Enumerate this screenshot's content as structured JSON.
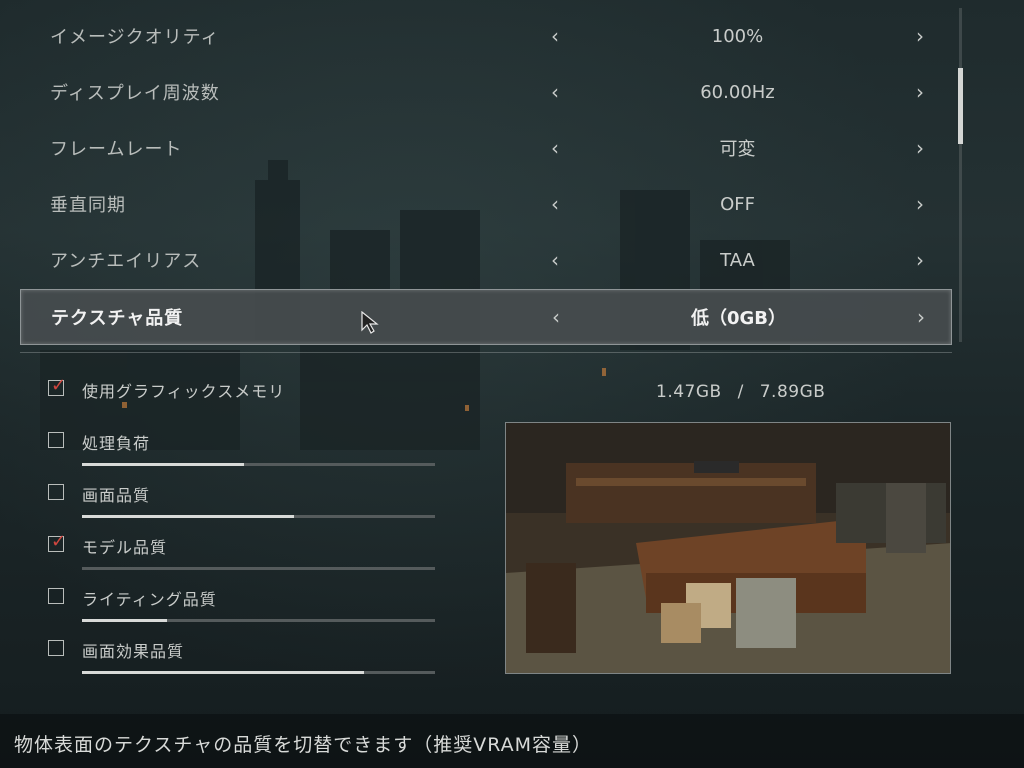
{
  "settings": {
    "rows": [
      {
        "label": "イメージクオリティ",
        "value": "100%"
      },
      {
        "label": "ディスプレイ周波数",
        "value": "60.00Hz"
      },
      {
        "label": "フレームレート",
        "value": "可変"
      },
      {
        "label": "垂直同期",
        "value": "OFF"
      },
      {
        "label": "アンチエイリアス",
        "value": "TAA"
      },
      {
        "label": "テクスチャ品質",
        "value": "低（0GB）"
      }
    ],
    "selected_index": 5,
    "arrow_left": "‹",
    "arrow_right": "›"
  },
  "scroll": {
    "position": 0.18
  },
  "checks": [
    {
      "label": "使用グラフィックスメモリ",
      "checked": true,
      "meter": null
    },
    {
      "label": "処理負荷",
      "checked": false,
      "meter": 0.46
    },
    {
      "label": "画面品質",
      "checked": false,
      "meter": 0.6
    },
    {
      "label": "モデル品質",
      "checked": true,
      "meter": 0.0
    },
    {
      "label": "ライティング品質",
      "checked": false,
      "meter": 0.24
    },
    {
      "label": "画面効果品質",
      "checked": false,
      "meter": 0.8
    }
  ],
  "check_mark": "✓",
  "vram": {
    "used": "1.47GB",
    "separator": "/",
    "total": "7.89GB"
  },
  "footer": {
    "description": "物体表面のテクスチャの品質を切替できます（推奨VRAM容量）"
  },
  "colors": {
    "accent_check": "#d0463f",
    "meter_fill": "#d8dad8"
  }
}
